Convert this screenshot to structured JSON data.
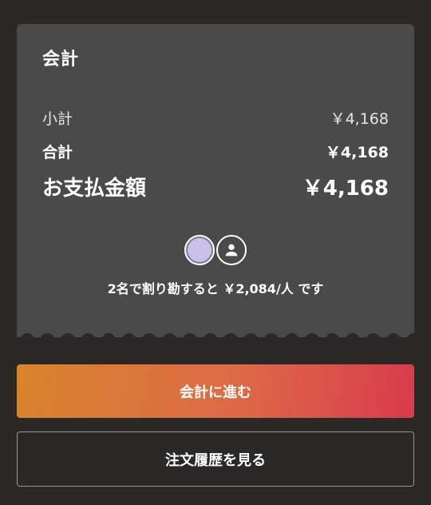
{
  "checkout": {
    "title": "会計",
    "subtotal_label": "小計",
    "subtotal_value": "￥4,168",
    "total_label": "合計",
    "total_value": "￥4,168",
    "payment_label": "お支払金額",
    "payment_value": "￥4,168",
    "participants": [
      {
        "type": "photo",
        "icon": "user-photo-avatar"
      },
      {
        "type": "default",
        "icon": "person-icon"
      }
    ],
    "split_text": "2名で割り勘すると ￥2,084/人 です"
  },
  "actions": {
    "proceed_label": "会計に進む",
    "history_label": "注文履歴を見る"
  },
  "colors": {
    "background": "#2b2828",
    "card": "#4a4a4a",
    "gradient_start": "#d8842c",
    "gradient_end": "#d93a4c"
  }
}
